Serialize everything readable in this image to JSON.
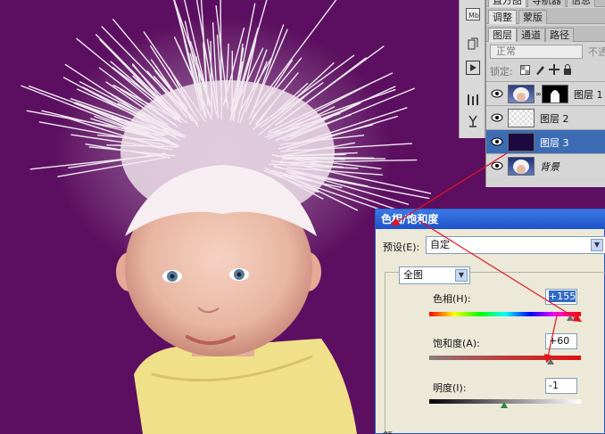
{
  "panel_tabs_top": [
    "直方图",
    "导航器",
    "信息"
  ],
  "panel_tabs_mid": [
    "调整",
    "蒙版"
  ],
  "panel_tabs_layers": [
    "图层",
    "通道",
    "路径"
  ],
  "blend_mode": "正常",
  "opacity_label": "不透",
  "lock_label": "锁定:",
  "layers": [
    {
      "name": "图层 1",
      "selected": false,
      "has_mask": true
    },
    {
      "name": "图层 2",
      "selected": false,
      "has_mask": false
    },
    {
      "name": "图层 3",
      "selected": true,
      "has_mask": false
    },
    {
      "name": "背景",
      "selected": false,
      "has_mask": false
    }
  ],
  "dialog": {
    "title": "色相/饱和度",
    "preset_label": "预设(E):",
    "preset_value": "自定",
    "edit_value": "全图",
    "hue_label": "色相(H):",
    "hue_value": "+155",
    "hue_level": 155,
    "saturation_label": "饱和度(A):",
    "saturation_value": "+60",
    "saturation_level": 60,
    "lightness_label": "明度(I):",
    "lightness_value": "-1",
    "lightness_level": -1,
    "footer_label": "颜"
  },
  "colors": {
    "canvas_bg": "#5c0f60",
    "selected_layer": "#3c6cb4",
    "annotation_arrow": "#e0141e"
  }
}
